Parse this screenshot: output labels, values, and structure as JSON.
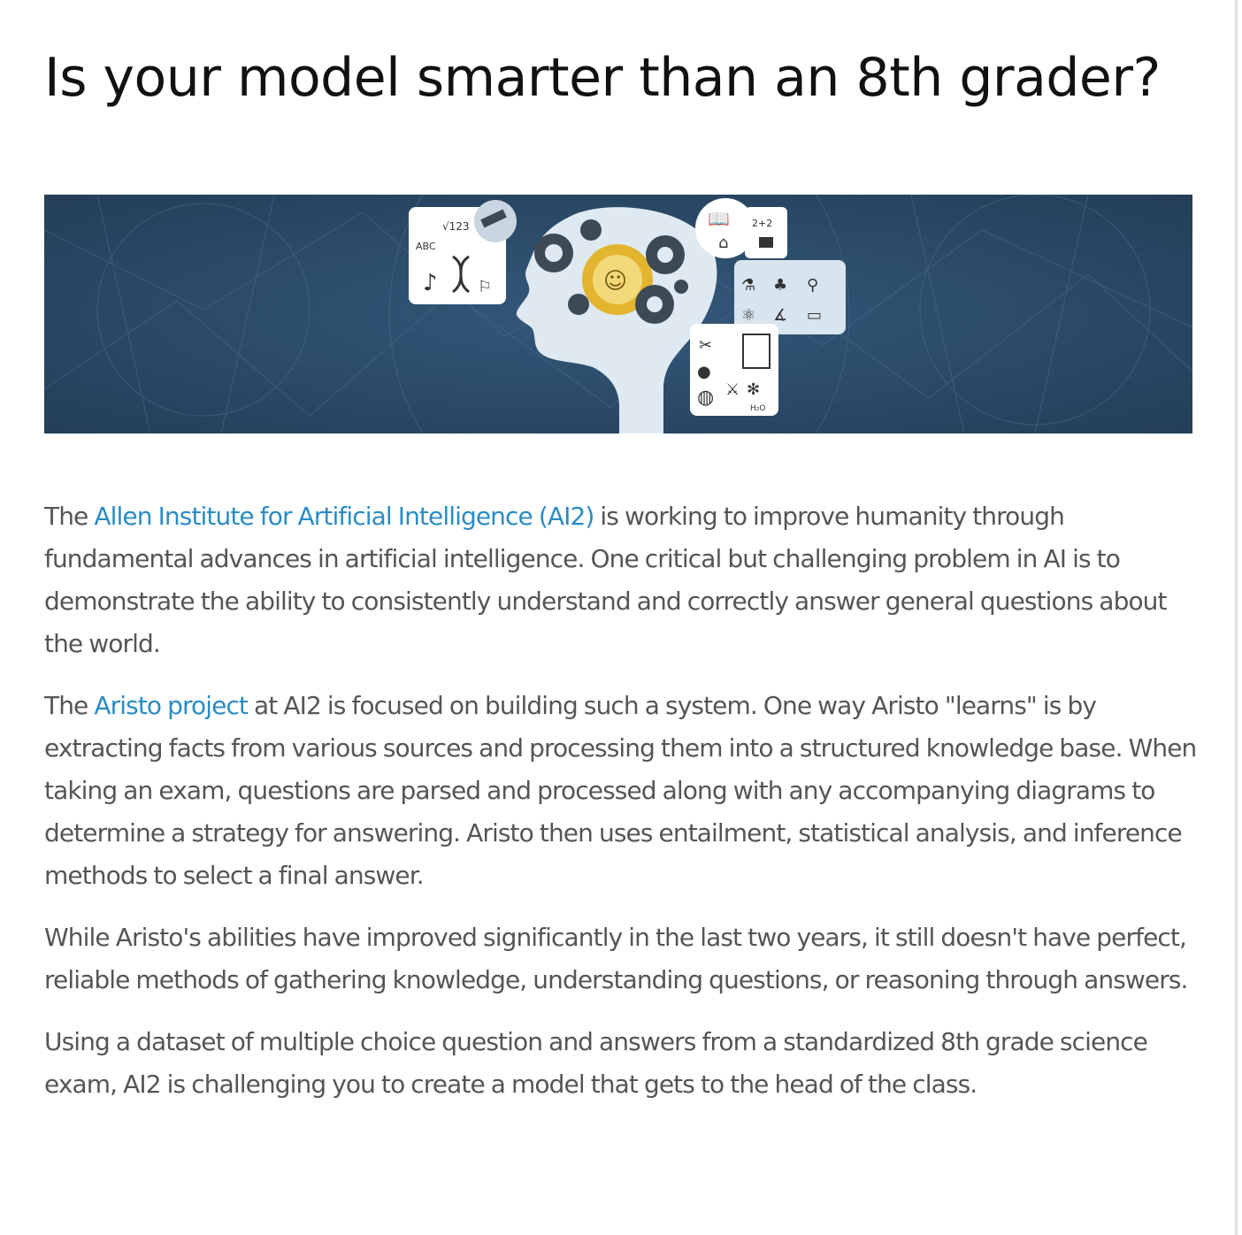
{
  "page": {
    "title": "Is your model smarter than an 8th grader?"
  },
  "banner": {
    "icon_texts": {
      "sqrt": "√123",
      "abc": "ABC",
      "two_plus_two": "2+2",
      "h2o": "H₂O"
    },
    "colors": {
      "background": "#2a4a66",
      "head": "#dfe9f1",
      "gear_gold": "#e3b52e",
      "gear_dark": "#3d4a55"
    }
  },
  "article": {
    "p1": {
      "pre": "The ",
      "link": "Allen Institute for Artificial Intelligence (AI2)",
      "post": " is working to improve humanity through fundamental advances in artificial intelligence. One critical but challenging problem in AI is to demonstrate the ability to consistently understand and correctly answer general questions about the world."
    },
    "p2": {
      "pre": "The ",
      "link": "Aristo project",
      "post": " at AI2 is focused on building such a system. One way Aristo \"learns\" is by extracting facts from various sources and processing them into a structured knowledge base. When taking an exam, questions are parsed and processed along with any accompanying diagrams to determine a strategy for answering. Aristo then uses entailment, statistical analysis, and inference methods to select a final answer."
    },
    "p3": "While Aristo's abilities have improved significantly in the last two years, it still doesn't have perfect, reliable methods of gathering knowledge, understanding questions, or reasoning through answers.",
    "p4": "Using a dataset of multiple choice question and answers from a standardized 8th grade science exam, AI2 is challenging you to create a model that gets to the head of the class."
  },
  "colors": {
    "link": "#2a8cc4",
    "body_text": "#555555",
    "title_text": "#111111"
  }
}
